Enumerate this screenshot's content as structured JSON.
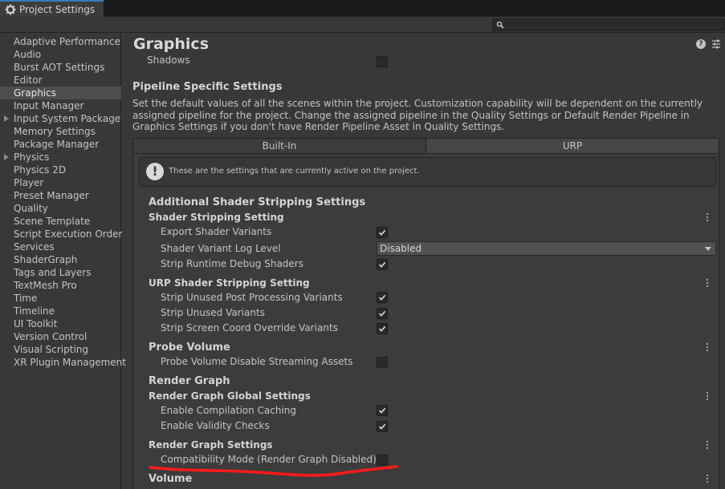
{
  "window": {
    "tab_title": "Project Settings"
  },
  "search": {
    "value": ""
  },
  "sidebar": {
    "items": [
      {
        "label": "Adaptive Performance"
      },
      {
        "label": "Audio"
      },
      {
        "label": "Burst AOT Settings"
      },
      {
        "label": "Editor"
      },
      {
        "label": "Graphics",
        "selected": true
      },
      {
        "label": "Input Manager"
      },
      {
        "label": "Input System Package",
        "foldout": true
      },
      {
        "label": "Memory Settings"
      },
      {
        "label": "Package Manager"
      },
      {
        "label": "Physics",
        "foldout": true
      },
      {
        "label": "Physics 2D"
      },
      {
        "label": "Player"
      },
      {
        "label": "Preset Manager"
      },
      {
        "label": "Quality"
      },
      {
        "label": "Scene Template"
      },
      {
        "label": "Script Execution Order"
      },
      {
        "label": "Services"
      },
      {
        "label": "ShaderGraph"
      },
      {
        "label": "Tags and Layers"
      },
      {
        "label": "TextMesh Pro"
      },
      {
        "label": "Time"
      },
      {
        "label": "Timeline"
      },
      {
        "label": "UI Toolkit"
      },
      {
        "label": "Version Control"
      },
      {
        "label": "Visual Scripting"
      },
      {
        "label": "XR Plugin Management"
      }
    ]
  },
  "main": {
    "title": "Graphics",
    "shadows_label": "Shadows",
    "shadows_checked": false,
    "pipeline_heading": "Pipeline Specific Settings",
    "pipeline_desc": "Set the default values of all the scenes within the project. Customization capability will be dependent on the currently assigned pipeline for the project. Change the assigned pipeline in the Quality Settings or Default Render Pipeline in Graphics Settings if you don't have Render Pipeline Asset in Quality Settings.",
    "tabs": [
      {
        "label": "Built-In"
      },
      {
        "label": "URP",
        "active": true
      }
    ],
    "info_text": "These are the settings that are currently active on the project.",
    "additional_heading": "Additional Shader Stripping Settings",
    "shader_stripping": {
      "title": "Shader Stripping Setting",
      "export_label": "Export Shader Variants",
      "export_checked": true,
      "log_level_label": "Shader Variant Log Level",
      "log_level_value": "Disabled",
      "strip_debug_label": "Strip Runtime Debug Shaders",
      "strip_debug_checked": true
    },
    "urp_stripping": {
      "title": "URP Shader Stripping Setting",
      "post_label": "Strip Unused Post Processing Variants",
      "post_checked": true,
      "unused_label": "Strip Unused Variants",
      "unused_checked": true,
      "coord_label": "Strip Screen Coord Override Variants",
      "coord_checked": true
    },
    "probe_volume": {
      "title": "Probe Volume",
      "disable_label": "Probe Volume Disable Streaming Assets",
      "disable_checked": false
    },
    "render_graph": {
      "heading": "Render Graph",
      "global_title": "Render Graph Global Settings",
      "caching_label": "Enable Compilation Caching",
      "caching_checked": true,
      "validity_label": "Enable Validity Checks",
      "validity_checked": true,
      "settings_title": "Render Graph Settings",
      "compat_label": "Compatibility Mode (Render Graph Disabled)",
      "compat_checked": false
    },
    "volume_heading": "Volume"
  },
  "colors": {
    "accent": "#3a79bb",
    "annotation": "#ff1a1a"
  }
}
